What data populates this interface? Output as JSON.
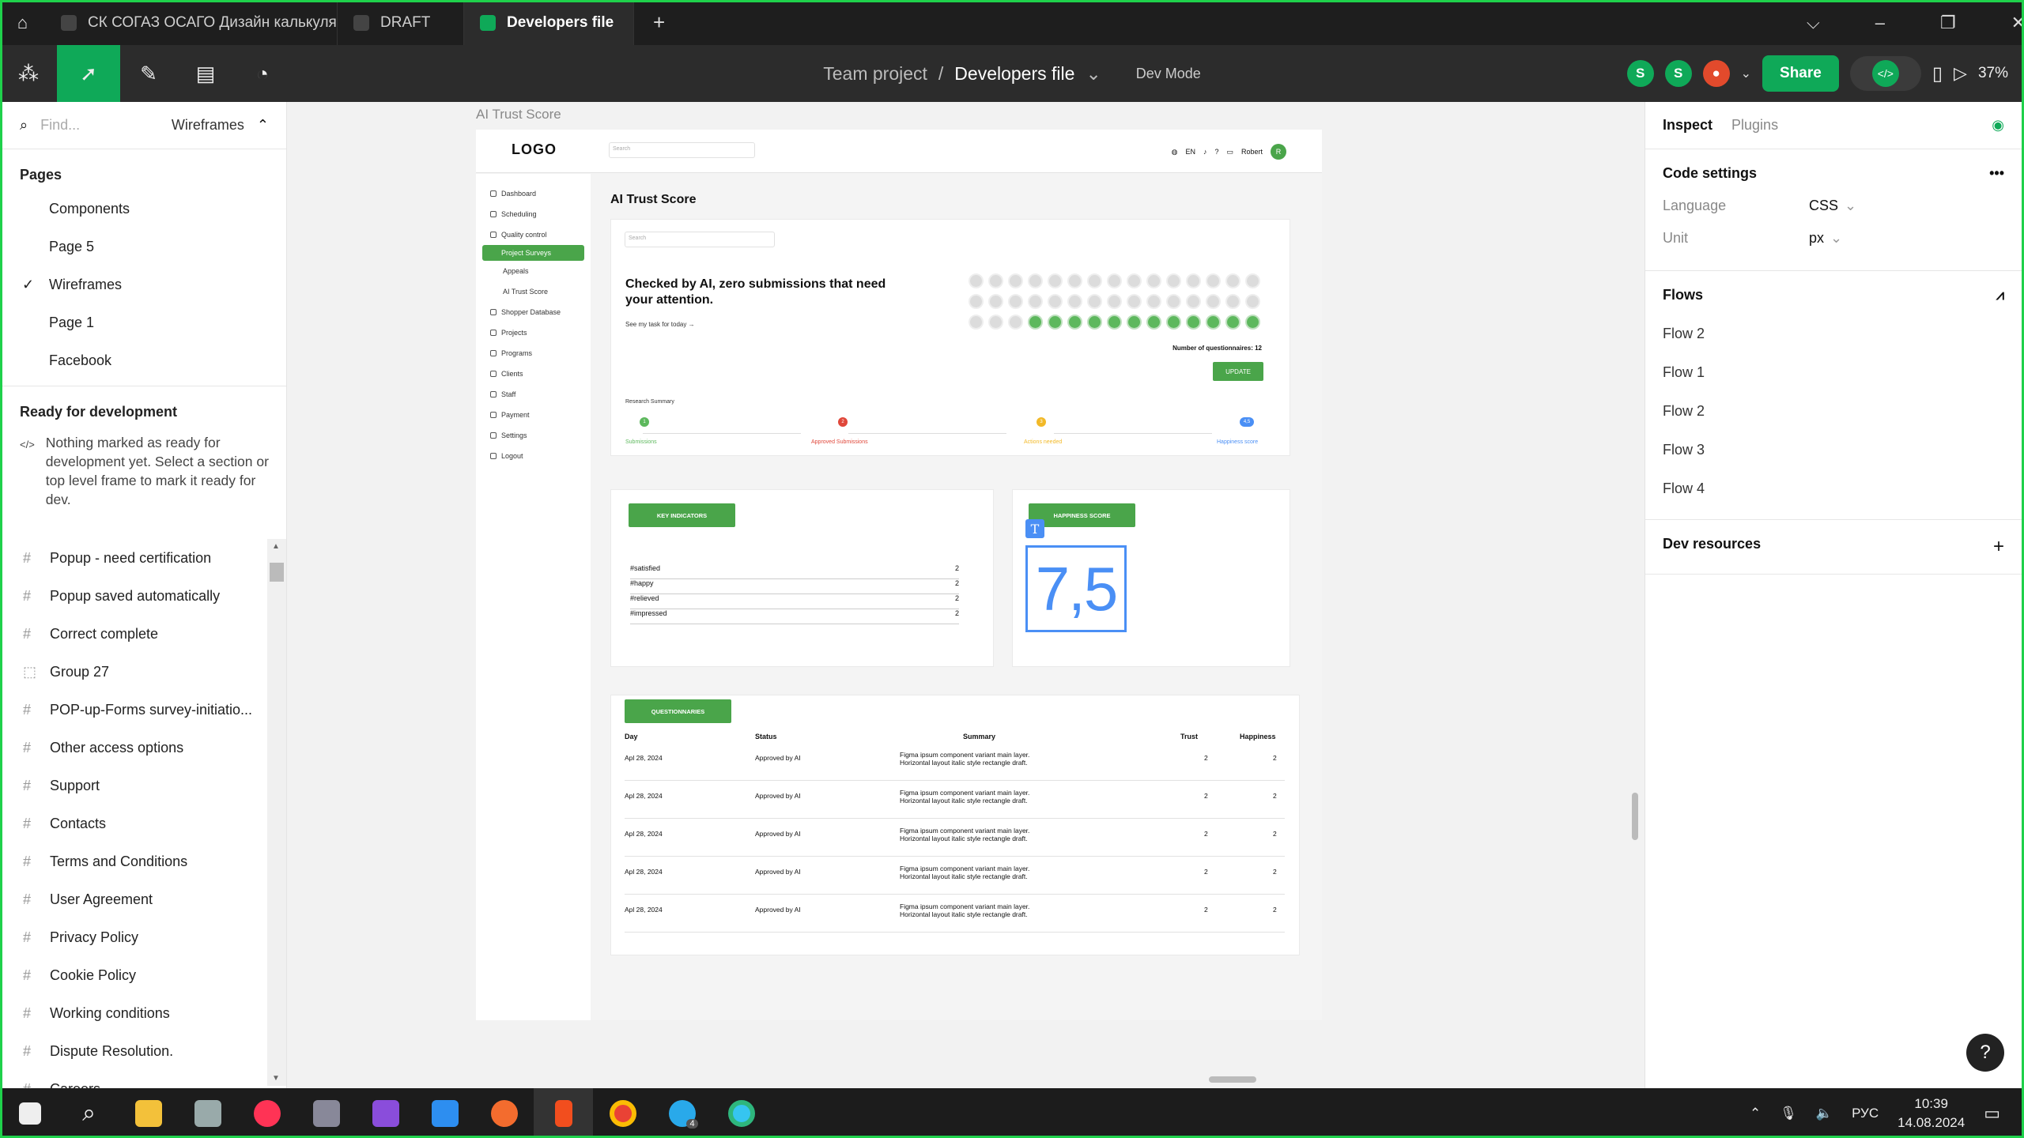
{
  "tabs": [
    {
      "label": "СК СОГАЗ ОСАГО Дизайн калькуля"
    },
    {
      "label": "DRAFT"
    },
    {
      "label": "Developers file"
    }
  ],
  "toolbar": {
    "project": "Team project",
    "separator": "/",
    "file": "Developers file",
    "mode": "Dev Mode",
    "avatar1": "S",
    "avatar2": "S",
    "share": "Share",
    "zoom": "37%"
  },
  "left": {
    "search_placeholder": "Find...",
    "page_selector": "Wireframes",
    "pages_title": "Pages",
    "pages": [
      "Components",
      "Page 5",
      "Wireframes",
      "Page 1",
      "Facebook"
    ],
    "ready_title": "Ready for development",
    "ready_text": "Nothing marked as ready for development yet. Select a section or top level frame to mark it ready for dev.",
    "layers": [
      "Popup - need certification",
      "Popup saved automatically",
      "Correct complete",
      "Group 27",
      "POP-up-Forms survey-initiatio...",
      "Other access options",
      "Support",
      "Contacts",
      "Terms and Conditions",
      "User Agreement",
      "Privacy Policy",
      "Cookie Policy",
      "Working conditions",
      "Dispute Resolution.",
      "Careers"
    ]
  },
  "frame": {
    "label": "AI Trust Score",
    "logo": "LOGO",
    "search": "Search",
    "lang": "EN",
    "user": "Robert",
    "avatar": "R",
    "title": "AI Trust Score",
    "nav": [
      "Dashboard",
      "Scheduling",
      "Quality control",
      "Project Surveys",
      "Appeals",
      "AI Trust Score",
      "Shopper Database",
      "Projects",
      "Programs",
      "Clients",
      "Staff",
      "Payment",
      "Settings",
      "Logout"
    ],
    "card_search": "Search",
    "heading": "Checked by AI, zero submissions that need your attention.",
    "task_link": "See my task for today →",
    "questionnaires_count": "Number of questionnaires: 12",
    "update": "UPDATE",
    "research": "Research Summary",
    "steps": [
      {
        "label": "Submissions",
        "value": "1",
        "color": "#5db85d"
      },
      {
        "label": "Approved Submissions",
        "value": "2",
        "color": "#e0473a"
      },
      {
        "label": "Actions needed",
        "value": "3",
        "color": "#f2b928"
      },
      {
        "label": "Happiness score",
        "value": "4,5",
        "color": "#4a8ff5"
      }
    ],
    "ki_btn": "KEY INDICATORS",
    "indicators": [
      {
        "k": "#satisfied",
        "v": "2"
      },
      {
        "k": "#happy",
        "v": "2"
      },
      {
        "k": "#relieved",
        "v": "2"
      },
      {
        "k": "#impressed",
        "v": "2"
      }
    ],
    "hs_btn": "HAPPINESS SCORE",
    "hs_value": "7,5",
    "q_btn": "QUESTIONNARIES",
    "cols": [
      "Day",
      "Status",
      "Summary",
      "Trust",
      "Happiness"
    ],
    "rows": [
      {
        "day": "Apl 28, 2024",
        "status": "Approved by AI",
        "summary": "Figma ipsum component variant main layer. Horizontal layout italic style rectangle draft.",
        "trust": "2",
        "happy": "2"
      },
      {
        "day": "Apl 28, 2024",
        "status": "Approved by AI",
        "summary": "Figma ipsum component variant main layer. Horizontal layout italic style rectangle draft.",
        "trust": "2",
        "happy": "2"
      },
      {
        "day": "Apl 28, 2024",
        "status": "Approved by AI",
        "summary": "Figma ipsum component variant main layer. Horizontal layout italic style rectangle draft.",
        "trust": "2",
        "happy": "2"
      },
      {
        "day": "Apl 28, 2024",
        "status": "Approved by AI",
        "summary": "Figma ipsum component variant main layer. Horizontal layout italic style rectangle draft.",
        "trust": "2",
        "happy": "2"
      },
      {
        "day": "Apl 28, 2024",
        "status": "Approved by AI",
        "summary": "Figma ipsum component variant main layer. Horizontal layout italic style rectangle draft.",
        "trust": "2",
        "happy": "2"
      }
    ]
  },
  "right": {
    "tab_inspect": "Inspect",
    "tab_plugins": "Plugins",
    "code_settings": "Code settings",
    "language_label": "Language",
    "language": "CSS",
    "unit_label": "Unit",
    "unit": "px",
    "flows_title": "Flows",
    "flows": [
      "Flow 2",
      "Flow 1",
      "Flow 2",
      "Flow 3",
      "Flow 4"
    ],
    "dev_resources": "Dev resources"
  },
  "taskbar": {
    "lang": "РУС",
    "time": "10:39",
    "date": "14.08.2024",
    "badge": "4"
  },
  "colors": {
    "accent": "#0fa958",
    "frame_green": "#4aa54a",
    "selection": "#4a8ff5"
  }
}
